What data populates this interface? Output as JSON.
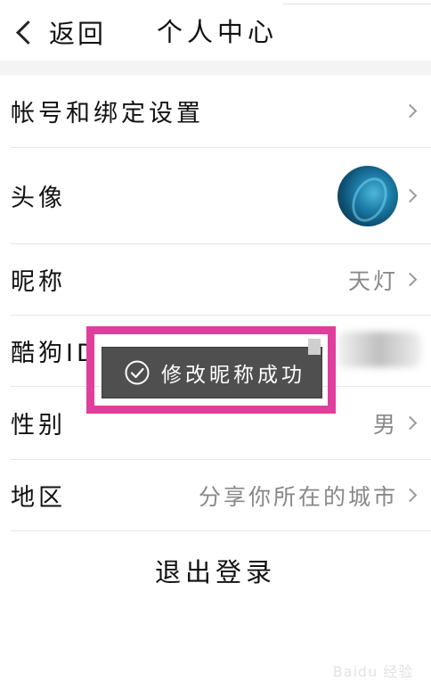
{
  "header": {
    "back_label": "返回",
    "title": "个人中心"
  },
  "rows": [
    {
      "label": "帐号和绑定设置",
      "value": ""
    },
    {
      "label": "头像",
      "value": ""
    },
    {
      "label": "昵称",
      "value": "天灯"
    },
    {
      "label": "酷狗ID",
      "value": ""
    },
    {
      "label": "性别",
      "value": "男"
    },
    {
      "label": "地区",
      "value": "分享你所在的城市"
    }
  ],
  "logout_label": "退出登录",
  "toast": {
    "message": "修改昵称成功",
    "icon": "check-circle-icon"
  },
  "colors": {
    "highlight": "#e03e9c",
    "toast_bg": "#4f4f4f",
    "separator": "#e6e6e6"
  },
  "watermark": {
    "text": "Baidu 经验"
  }
}
